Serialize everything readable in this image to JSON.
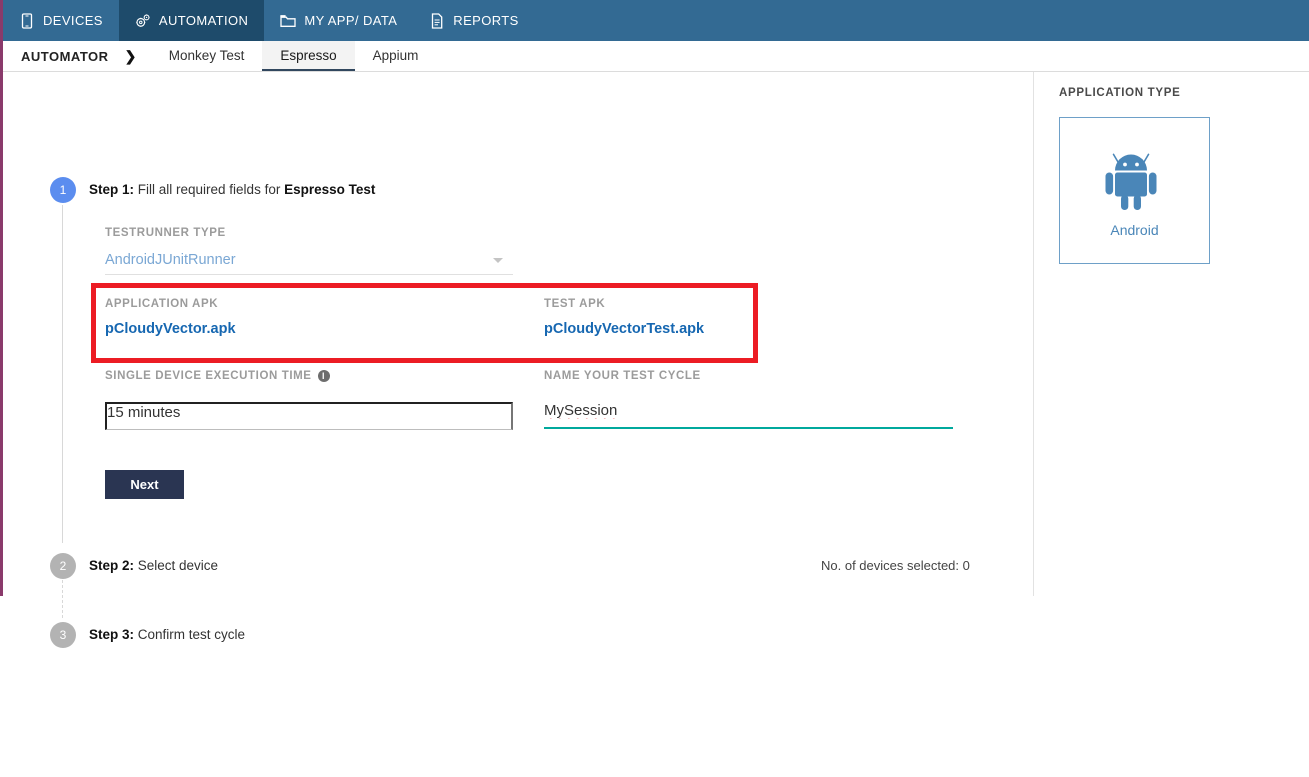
{
  "topnav": {
    "items": [
      {
        "label": "DEVICES",
        "icon": "phone-icon",
        "active": false
      },
      {
        "label": "AUTOMATION",
        "icon": "gears-icon",
        "active": true
      },
      {
        "label": "MY APP/ DATA",
        "icon": "folder-icon",
        "active": false
      },
      {
        "label": "REPORTS",
        "icon": "document-icon",
        "active": false
      }
    ]
  },
  "tabbar": {
    "section": "AUTOMATOR",
    "chevron": "❯",
    "tabs": [
      {
        "label": "Monkey Test",
        "active": false
      },
      {
        "label": "Espresso",
        "active": true
      },
      {
        "label": "Appium",
        "active": false
      }
    ]
  },
  "steps": {
    "step1": {
      "number": "1",
      "prefix": "Step 1:",
      "text": " Fill all required fields for ",
      "emphasis": "Espresso Test"
    },
    "step2": {
      "number": "2",
      "prefix": "Step 2:",
      "text": " Select device",
      "devices_selected": "No. of devices selected: 0"
    },
    "step3": {
      "number": "3",
      "prefix": "Step 3:",
      "text": " Confirm test cycle"
    }
  },
  "form": {
    "testrunner": {
      "label": "TESTRUNNER TYPE",
      "value": "AndroidJUnitRunner"
    },
    "application_apk": {
      "label": "APPLICATION APK",
      "value": "pCloudyVector.apk"
    },
    "test_apk": {
      "label": "TEST APK",
      "value": "pCloudyVectorTest.apk"
    },
    "execution_time": {
      "label": "SINGLE DEVICE EXECUTION TIME",
      "info_icon": "info-icon",
      "value": "15 minutes"
    },
    "test_cycle": {
      "label": "NAME YOUR TEST CYCLE",
      "value": "MySession"
    },
    "next_button": "Next"
  },
  "sidebar": {
    "title": "APPLICATION TYPE",
    "card": {
      "label": "Android",
      "icon": "android-robot-icon"
    }
  },
  "colors": {
    "nav_bg": "#336a93",
    "nav_active": "#1e4b6b",
    "accent_blue": "#1667b1",
    "step_active": "#5b8def",
    "highlight_red": "#ec1c24",
    "underline_teal": "#00a99d",
    "button_navy": "#2a3552",
    "android_blue": "#4a86b8",
    "rail_purple": "#8a3a6b"
  }
}
